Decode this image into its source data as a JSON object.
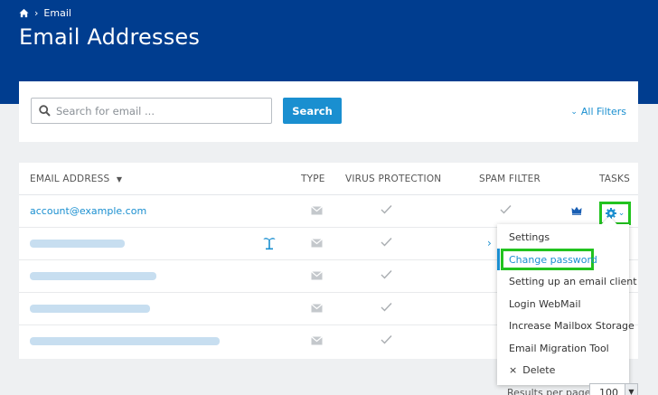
{
  "breadcrumb": {
    "home_icon": "home-icon",
    "current": "Email"
  },
  "page_title": "Email Addresses",
  "search": {
    "placeholder": "Search for email ...",
    "button_label": "Search",
    "filters_label": "All Filters"
  },
  "table": {
    "headers": {
      "email": "EMAIL ADDRESS",
      "type": "TYPE",
      "virus": "VIRUS PROTECTION",
      "spam": "SPAM FILTER",
      "tasks": "TASKS"
    },
    "first_email": "account@example.com"
  },
  "tasks_menu": {
    "items": [
      "Settings",
      "Change password",
      "Setting up an email client",
      "Login WebMail",
      "Increase Mailbox Storage",
      "Email Migration Tool",
      "Delete"
    ],
    "delete_prefix": "×"
  },
  "pagination": {
    "label": "Results per page",
    "value": "100"
  },
  "colors": {
    "header_bg": "#003d8f",
    "accent": "#1a8fd0",
    "highlight": "#22c31f"
  }
}
